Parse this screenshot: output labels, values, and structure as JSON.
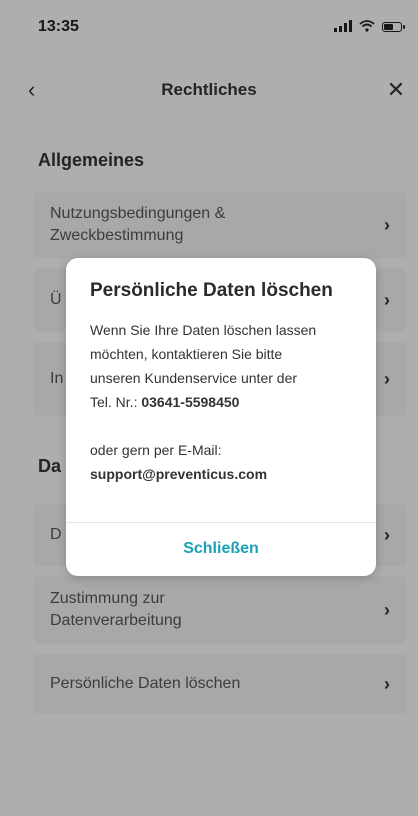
{
  "status_bar": {
    "time": "13:35"
  },
  "header": {
    "title": "Rechtliches",
    "back_icon": "‹",
    "close_icon": "✕"
  },
  "sections": [
    {
      "title": "Allgemeines"
    },
    {
      "title": "Da"
    }
  ],
  "rows": [
    {
      "label_line1": "Nutzungsbedingungen &",
      "label_line2": "Zweckbestimmung"
    },
    {
      "label": "Ü"
    },
    {
      "label": "In"
    },
    {
      "label": "D"
    },
    {
      "label_line1": "Zustimmung zur",
      "label_line2": "Datenverarbeitung"
    },
    {
      "label": "Persönliche Daten löschen"
    }
  ],
  "chevron": "›",
  "dialog": {
    "title": "Persönliche Daten löschen",
    "line1": "Wenn Sie Ihre Daten löschen lassen",
    "line2": "möchten, kontaktieren Sie bitte",
    "line3": "unseren Kundenservice unter der",
    "phone_prefix": "Tel. Nr.: ",
    "phone": "03641-5598450",
    "line5": "oder gern per E-Mail:",
    "email": "support@preventicus.com",
    "close_label": "Schließen"
  },
  "colors": {
    "accent": "#1aa1b6",
    "background": "#f1f1f1",
    "row": "#e9e9e9"
  }
}
